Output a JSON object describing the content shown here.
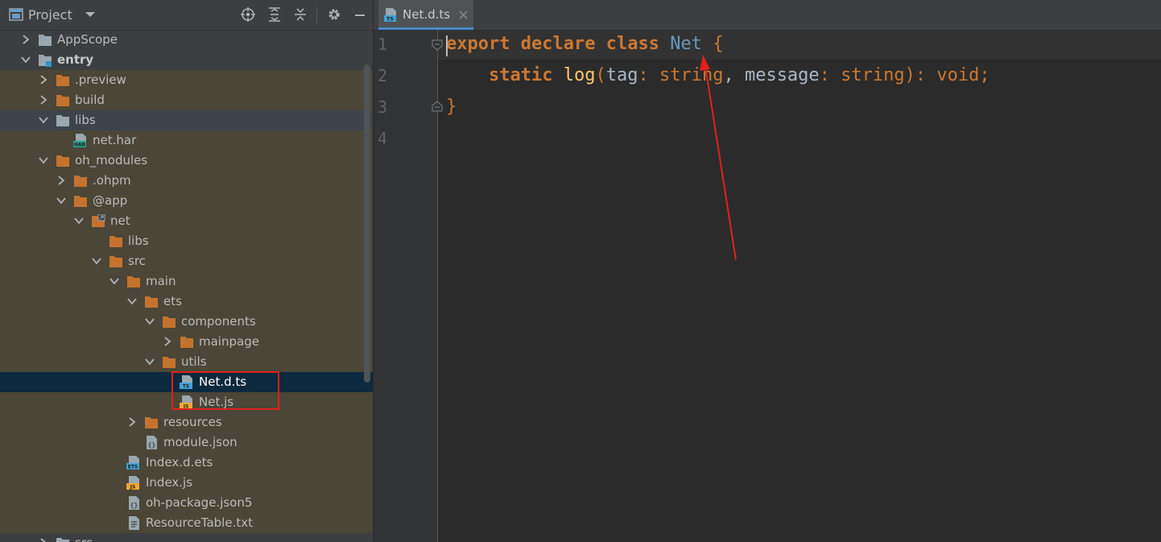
{
  "panel": {
    "title": "Project",
    "header_icons": [
      "project-view-icon",
      "dropdown-chevron-icon",
      "locate-icon",
      "expand-all-icon",
      "collapse-all-icon",
      "gear-icon",
      "hide-icon"
    ]
  },
  "tree": [
    {
      "label": "AppScope",
      "icon": "folder-gray",
      "expanded": false,
      "depth": 0,
      "style": "plain"
    },
    {
      "label": "entry",
      "icon": "module-folder",
      "expanded": true,
      "depth": 0,
      "style": "plain",
      "bold": true
    },
    {
      "label": ".preview",
      "icon": "folder-orange",
      "expanded": false,
      "depth": 1,
      "style": "excl"
    },
    {
      "label": "build",
      "icon": "folder-orange",
      "expanded": false,
      "depth": 1,
      "style": "excl"
    },
    {
      "label": "libs",
      "icon": "folder-gray",
      "expanded": true,
      "depth": 1,
      "style": "lib"
    },
    {
      "label": "net.har",
      "icon": "har-file",
      "expanded": null,
      "depth": 2,
      "style": "excl"
    },
    {
      "label": "oh_modules",
      "icon": "folder-orange",
      "expanded": true,
      "depth": 1,
      "style": "excl"
    },
    {
      "label": ".ohpm",
      "icon": "folder-orange",
      "expanded": false,
      "depth": 2,
      "style": "excl"
    },
    {
      "label": "@app",
      "icon": "folder-orange",
      "expanded": true,
      "depth": 2,
      "style": "excl"
    },
    {
      "label": "net",
      "icon": "folder-link",
      "expanded": true,
      "depth": 3,
      "style": "excl"
    },
    {
      "label": "libs",
      "icon": "folder-orange",
      "expanded": null,
      "depth": 4,
      "style": "excl"
    },
    {
      "label": "src",
      "icon": "folder-orange",
      "expanded": true,
      "depth": 4,
      "style": "excl"
    },
    {
      "label": "main",
      "icon": "folder-orange",
      "expanded": true,
      "depth": 5,
      "style": "excl"
    },
    {
      "label": "ets",
      "icon": "folder-orange",
      "expanded": true,
      "depth": 6,
      "style": "excl"
    },
    {
      "label": "components",
      "icon": "folder-orange",
      "expanded": true,
      "depth": 7,
      "style": "excl"
    },
    {
      "label": "mainpage",
      "icon": "folder-orange",
      "expanded": false,
      "depth": 8,
      "style": "excl"
    },
    {
      "label": "utils",
      "icon": "folder-orange",
      "expanded": true,
      "depth": 7,
      "style": "excl"
    },
    {
      "label": "Net.d.ts",
      "icon": "ts-file",
      "expanded": null,
      "depth": 8,
      "style": "sel"
    },
    {
      "label": "Net.js",
      "icon": "js-file",
      "expanded": null,
      "depth": 8,
      "style": "excl"
    },
    {
      "label": "resources",
      "icon": "folder-orange",
      "expanded": false,
      "depth": 6,
      "style": "excl"
    },
    {
      "label": "module.json",
      "icon": "json-file",
      "expanded": null,
      "depth": 6,
      "style": "excl"
    },
    {
      "label": "Index.d.ets",
      "icon": "ets-file",
      "expanded": null,
      "depth": 5,
      "style": "excl"
    },
    {
      "label": "Index.js",
      "icon": "js-file",
      "expanded": null,
      "depth": 5,
      "style": "excl"
    },
    {
      "label": "oh-package.json5",
      "icon": "json-file",
      "expanded": null,
      "depth": 5,
      "style": "excl"
    },
    {
      "label": "ResourceTable.txt",
      "icon": "text-file",
      "expanded": null,
      "depth": 5,
      "style": "excl"
    },
    {
      "label": "src",
      "icon": "folder-gray",
      "expanded": false,
      "depth": 1,
      "style": "plain"
    }
  ],
  "editor": {
    "tab_label": "Net.d.ts",
    "tab_icon": "ts-file-icon",
    "line_numbers": [
      "1",
      "2",
      "3",
      "4"
    ],
    "code": {
      "l1_export": "export",
      "l1_declare": "declare",
      "l1_class": "class",
      "l1_name": "Net",
      "l1_brace": "{",
      "l2_static": "static",
      "l2_fn": "log",
      "l2_open": "(",
      "l2_p1": "tag",
      "l2_colon1": ": ",
      "l2_t1": "string",
      "l2_comma": ", ",
      "l2_p2": "message",
      "l2_colon2": ": ",
      "l2_t2": "string",
      "l2_close": ")",
      "l2_colon3": ": ",
      "l2_void": "void",
      "l2_semi": ";",
      "l3_brace": "}"
    }
  },
  "colors": {
    "keyword": "#cc7832",
    "class_name": "#6897bb",
    "function": "#ffc66d",
    "annotation": "#e0201c",
    "selection": "#0d293e",
    "excluded_bg": "#4b4637"
  }
}
